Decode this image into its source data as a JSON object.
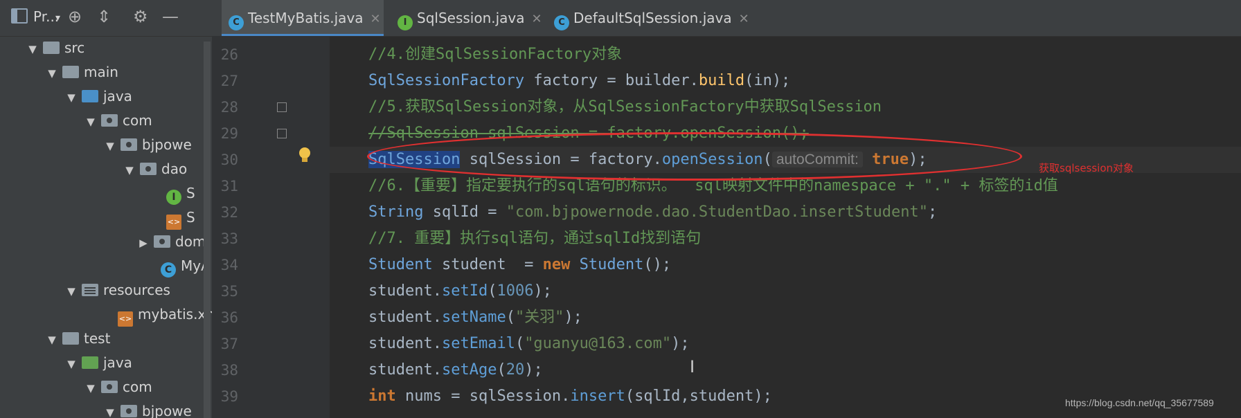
{
  "project_panel": {
    "title": "Pr...",
    "tree": [
      {
        "label": "src"
      },
      {
        "label": "main"
      },
      {
        "label": "java"
      },
      {
        "label": "com"
      },
      {
        "label": "bjpowe"
      },
      {
        "label": "dao"
      },
      {
        "label": "S"
      },
      {
        "label": "S"
      },
      {
        "label": "dom"
      },
      {
        "label": "MyA"
      },
      {
        "label": "resources"
      },
      {
        "label": "mybatis.xm"
      },
      {
        "label": "test"
      },
      {
        "label": "java"
      },
      {
        "label": "com"
      },
      {
        "label": "bjpowe"
      }
    ]
  },
  "tabs": [
    {
      "label": "TestMyBatis.java",
      "icon": "class-icon",
      "active": true
    },
    {
      "label": "SqlSession.java",
      "icon": "interface-icon",
      "active": false
    },
    {
      "label": "DefaultSqlSession.java",
      "icon": "class-icon",
      "active": false
    }
  ],
  "editor": {
    "line_numbers": [
      "26",
      "27",
      "28",
      "29",
      "30",
      "31",
      "32",
      "33",
      "34",
      "35",
      "36",
      "37",
      "38",
      "39"
    ],
    "l26": "//4.创建SqlSessionFactory对象",
    "l27_type": "SqlSessionFactory",
    "l27_mid": " factory = builder.",
    "l27_method": "build",
    "l27_end": "(in);",
    "l28": "//5.获取SqlSession对象，从SqlSessionFactory中获取SqlSession",
    "l29": "//SqlSession sqlSession = factory.openSession();",
    "l30_type": "SqlSession",
    "l30_mid": " sqlSession = factory.",
    "l30_method": "openSession",
    "l30_paren": "(",
    "l30_hint": "autoCommit:",
    "l30_kw": "true",
    "l30_end": ");",
    "l31": "//6.【重要】指定要执行的sql语句的标识。  sql映射文件中的namespace + \".\" + 标签的id值",
    "l32_type": "String",
    "l32_mid": " sqlId = ",
    "l32_str": "\"com.bjpowernode.dao.StudentDao.insertStudent\"",
    "l32_end": ";",
    "l33": "//7. 重要】执行sql语句，通过sqlId找到语句",
    "l34_type": "Student",
    "l34_mid": " student  = ",
    "l34_kw": "new",
    "l34_type2": " Student",
    "l34_end": "();",
    "l35_a": "student.",
    "l35_m": "setId",
    "l35_p": "(",
    "l35_n": "1006",
    "l35_e": ");",
    "l36_a": "student.",
    "l36_m": "setName",
    "l36_p": "(",
    "l36_s": "\"关羽\"",
    "l36_e": ");",
    "l37_a": "student.",
    "l37_m": "setEmail",
    "l37_p": "(",
    "l37_s": "\"guanyu@163.com\"",
    "l37_e": ");",
    "l38_a": "student.",
    "l38_m": "setAge",
    "l38_p": "(",
    "l38_n": "20",
    "l38_e": ");",
    "l39_kw": "int",
    "l39_mid": " nums = sqlSession.",
    "l39_m": "insert",
    "l39_e": "(sqlId,student);"
  },
  "annotation": "获取sqlsession对象",
  "watermark": "https://blog.csdn.net/qq_35677589",
  "colors": {
    "accent": "#4a88c7",
    "annotation": "#e03030",
    "comment": "#629755"
  }
}
